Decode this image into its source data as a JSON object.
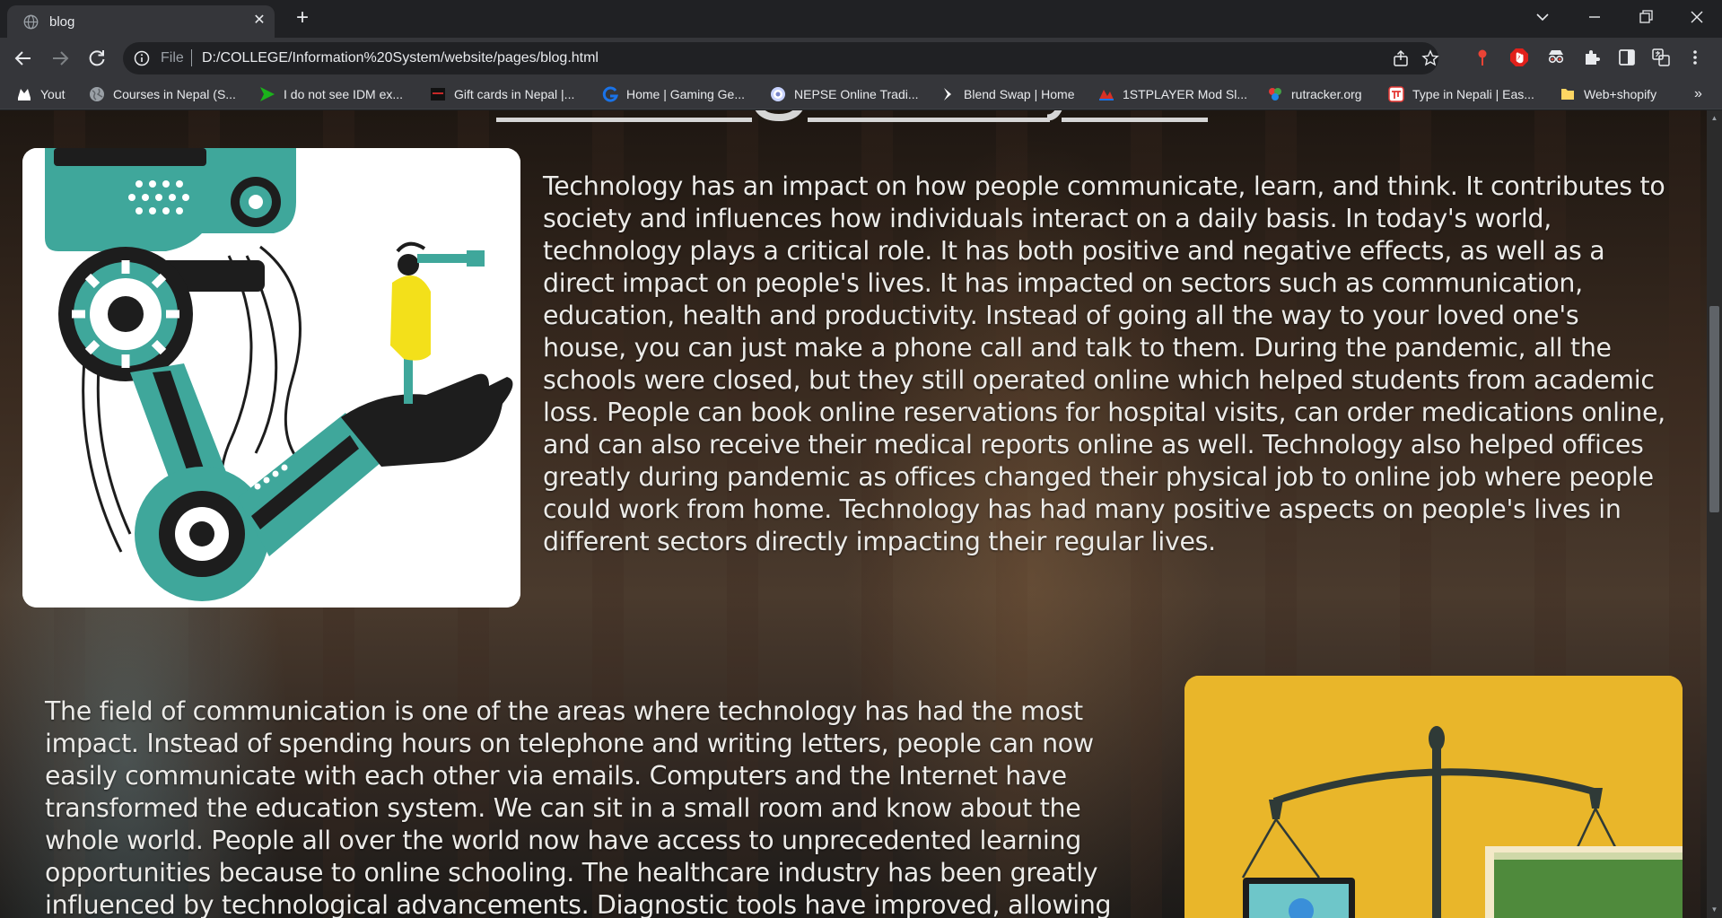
{
  "browser": {
    "tab_title": "blog",
    "url_scheme": "File",
    "url": "D:/COLLEGE/Information%20System/website/pages/blog.html",
    "bookmarks": [
      {
        "label": "Yout",
        "icon": "youtube-icon",
        "color": "#ffffff"
      },
      {
        "label": "Courses in Nepal (S...",
        "icon": "globe-icon",
        "color": "#9aa0a6"
      },
      {
        "label": "I do not see IDM ex...",
        "icon": "green-arrow-icon",
        "color": "#1bb31b"
      },
      {
        "label": "Gift cards in Nepal |...",
        "icon": "giftcard-icon",
        "color": "#111111"
      },
      {
        "label": "Home | Gaming Ge...",
        "icon": "gaming-icon",
        "color": "#1a73e8"
      },
      {
        "label": "NEPSE Online Tradi...",
        "icon": "nepse-icon",
        "color": "#c7d2fe"
      },
      {
        "label": "Blend Swap | Home",
        "icon": "blendswap-icon",
        "color": "#ffffff"
      },
      {
        "label": "1STPLAYER Mod Sl...",
        "icon": "1stplayer-icon",
        "color": "#d93025"
      },
      {
        "label": "rutracker.org",
        "icon": "rutracker-icon",
        "color": "#7cb342"
      },
      {
        "label": "Type in Nepali | Eas...",
        "icon": "nepali-icon",
        "color": "#e53935"
      },
      {
        "label": "Web+shopify",
        "icon": "folder-icon",
        "color": "#fdd663"
      }
    ],
    "overflow_label": "»"
  },
  "page": {
    "heading_fragment": "",
    "paragraph_1": "Technology has an impact on how people communicate, learn, and think. It contributes to society and influences how individuals interact on a daily basis. In today's world, technology plays a critical role. It has both positive and negative effects, as well as a direct impact on people's lives. It has impacted on sectors such as communication, education, health and productivity. Instead of going all the way to your loved one's house, you can just make a phone call and talk to them. During the pandemic, all the schools were closed, but they still operated online which helped students from academic loss. People can book online reservations for hospital visits, can order medications online, and can also receive their medical reports online as well. Technology also helped offices greatly during pandemic as offices changed their physical job to online job where people could work from home. Technology has had many positive aspects on people's lives in different sectors directly impacting their regular lives.",
    "paragraph_2": "The field of communication is one of the areas where technology has had the most impact. Instead of spending hours on telephone and writing letters, people can now easily communicate with each other via emails. Computers and the Internet have transformed the education system. We can sit in a small room and know about the whole world. People all over the world now have access to unprecedented learning opportunities because to online schooling. The healthcare industry has been greatly influenced by technological advancements. Diagnostic tools have improved, allowing",
    "image_1": "robotic-arm-telescope-illustration",
    "image_2": "balance-scale-illustration",
    "colors": {
      "accent_teal": "#3fa79b",
      "accent_yellow": "#e9b62a",
      "text": "#ecebe8"
    }
  }
}
